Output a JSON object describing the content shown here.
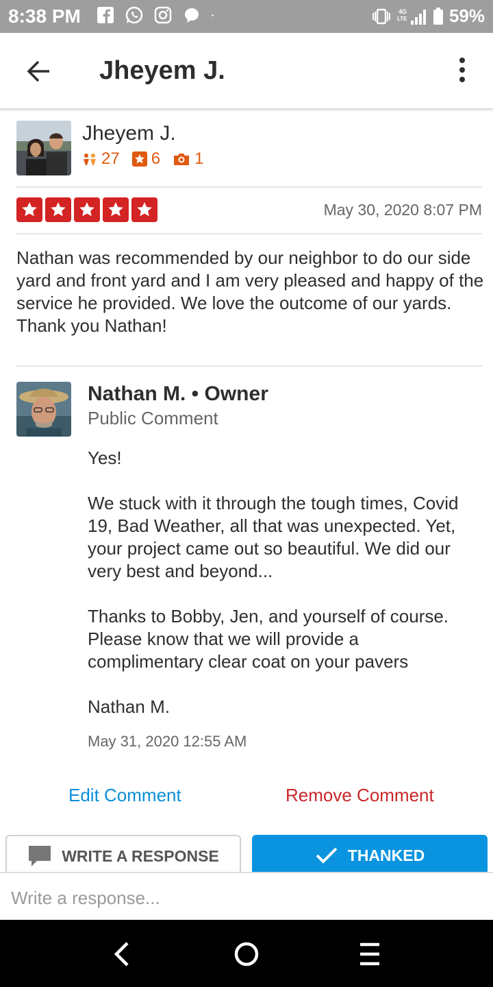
{
  "status_bar": {
    "time": "8:38 PM",
    "network": "4G LTE",
    "battery": "59%"
  },
  "header": {
    "title": "Jheyem J."
  },
  "review": {
    "user_name": "Jheyem J.",
    "friends": "27",
    "reviews": "6",
    "photos": "1",
    "rating": 5,
    "date": "May 30, 2020 8:07 PM",
    "text": "Nathan was recommended by our neighbor to do our side yard and front yard and I am very pleased and happy of the service he provided. We love the outcome of our yards. Thank you Nathan!"
  },
  "owner_comment": {
    "name": "Nathan M. • Owner",
    "label": "Public Comment",
    "paragraphs": [
      "Yes!",
      "We stuck with it through the tough times, Covid 19, Bad Weather, all that was unexpected.  Yet, your project came out so beautiful.  We did our very best and beyond...",
      "Thanks to Bobby, Jen, and yourself of course.  Please know that we will provide a complimentary clear coat on your pavers",
      "Nathan M."
    ],
    "date": "May 31, 2020 12:55 AM",
    "edit_label": "Edit Comment",
    "remove_label": "Remove Comment"
  },
  "actions": {
    "write_label": "WRITE A RESPONSE",
    "thanked_label": "THANKED"
  },
  "response": {
    "placeholder": "Write a response..."
  },
  "colors": {
    "star_red": "#d32323",
    "link_blue": "#0a8ed8",
    "remove_red": "#c8262a",
    "thanked_blue": "#0a94e0",
    "stat_orange": "#e05a10"
  }
}
